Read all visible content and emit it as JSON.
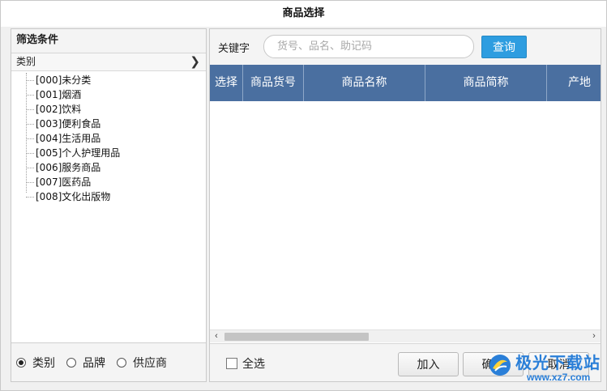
{
  "window": {
    "title": "商品选择"
  },
  "filter_panel": {
    "header": "筛选条件",
    "category_bar": {
      "label": "类别",
      "chevron_icon": "chevron-right-icon"
    },
    "tree_items": [
      "[000]未分类",
      "[001]烟酒",
      "[002]饮料",
      "[003]便利食品",
      "[004]生活用品",
      "[005]个人护理用品",
      "[006]服务商品",
      "[007]医药品",
      "[008]文化出版物"
    ],
    "radio_options": [
      {
        "label": "类别",
        "checked": true
      },
      {
        "label": "品牌",
        "checked": false
      },
      {
        "label": "供应商",
        "checked": false
      }
    ]
  },
  "search": {
    "label": "关键字",
    "value": "",
    "placeholder": "货号、品名、助记码",
    "button_label": "查询",
    "button_color": "#2e9de0"
  },
  "grid": {
    "header_color": "#4a6fa0",
    "columns": [
      "选择",
      "商品货号",
      "商品名称",
      "商品简称",
      "产地"
    ],
    "rows": []
  },
  "footer": {
    "select_all_label": "全选",
    "add_label": "加入",
    "ok_label": "确定",
    "cancel_label": "取消"
  },
  "watermark": {
    "name": "极光下载站",
    "url": "www.xz7.com",
    "color": "#2a7fd8"
  }
}
